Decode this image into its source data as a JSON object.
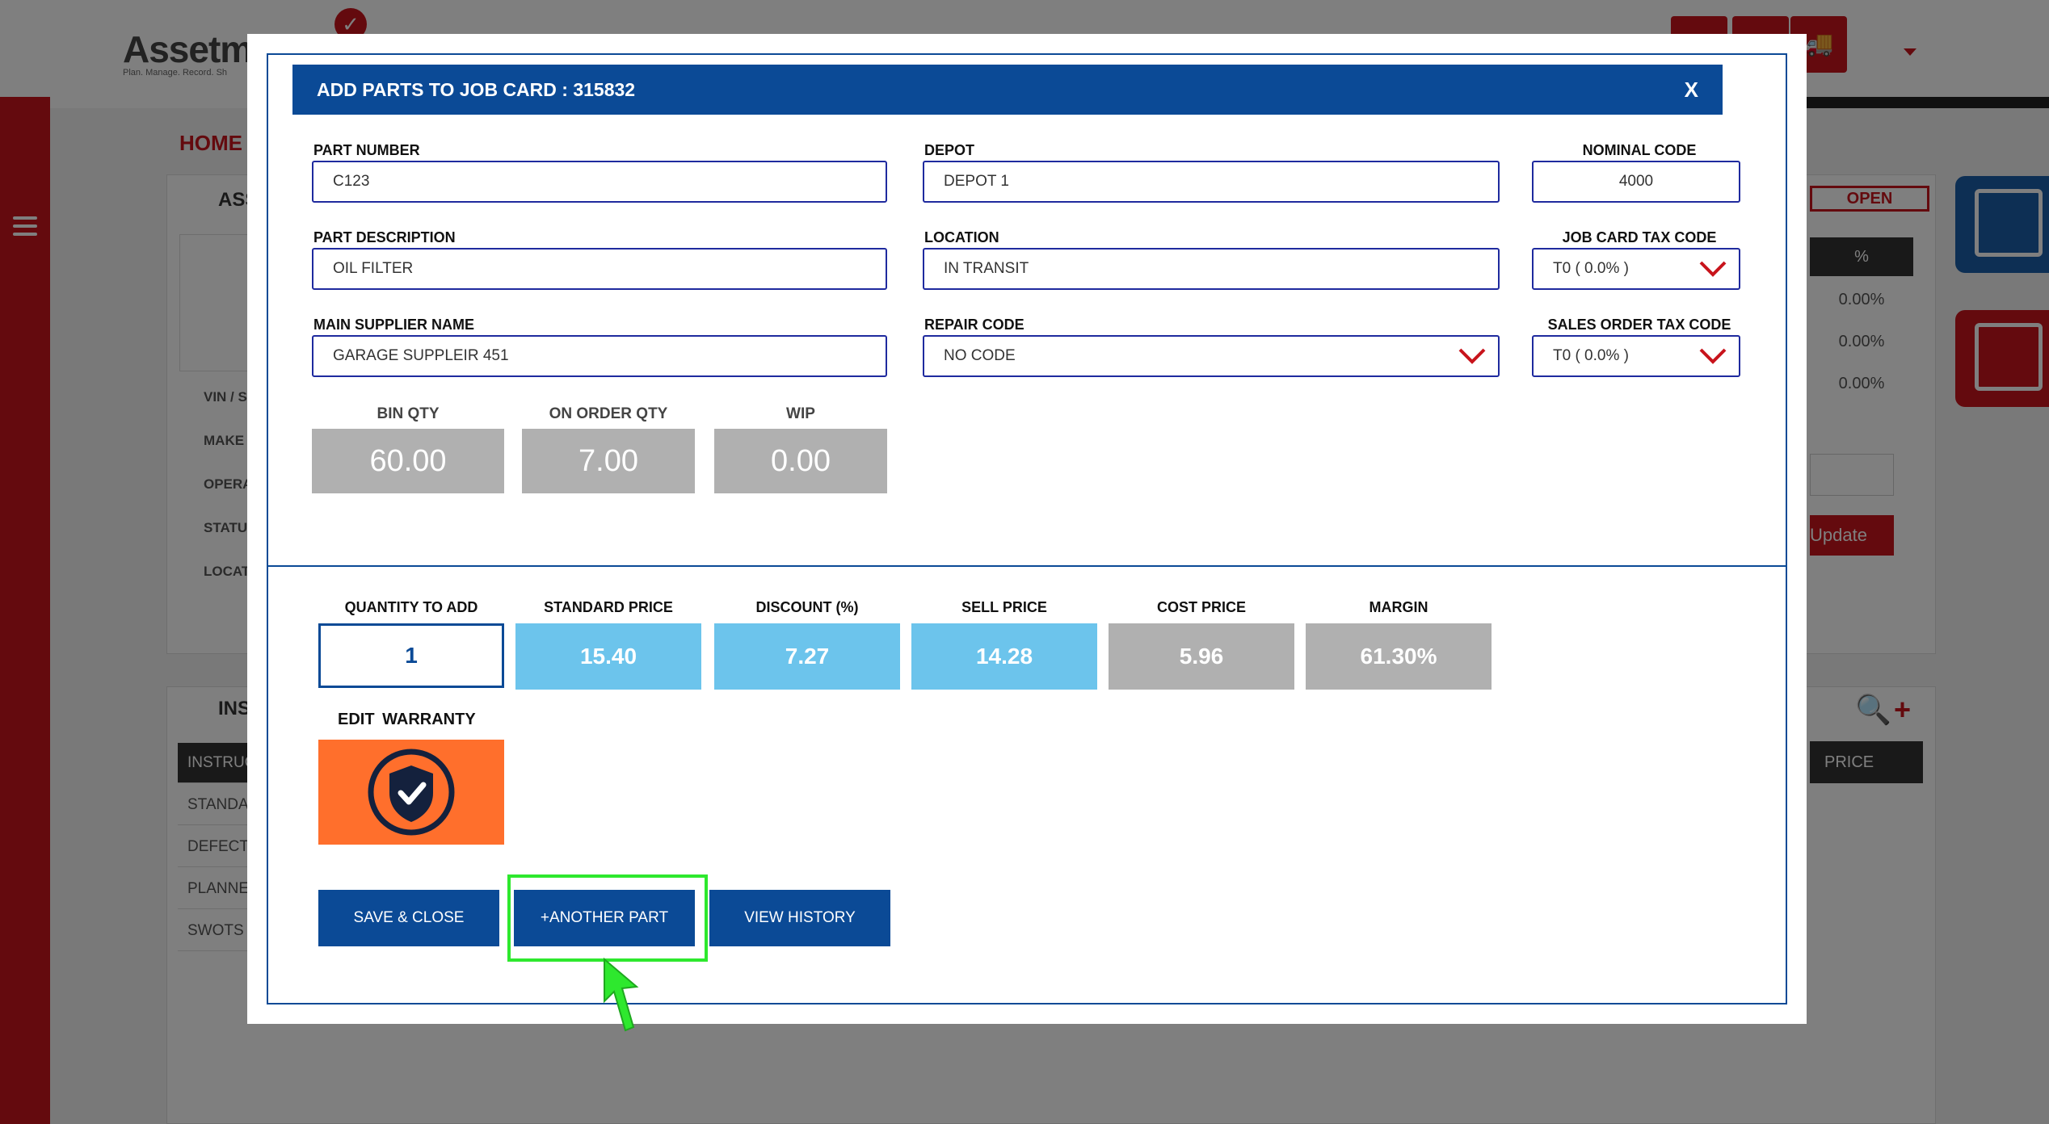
{
  "app": {
    "logo_text": "Assetm",
    "logo_tagline": "Plan. Manage. Record. Sh",
    "breadcrumb": "HOME F",
    "asset_panel_title": "ASS",
    "asset_fields": [
      "VIN / S",
      "MAKE /",
      "OPERA",
      "STATUS",
      "LOCAT"
    ],
    "instructions_panel_title": "INS",
    "instruction_items": [
      "INSTRUC",
      "STANDA",
      "DEFECT",
      "PLANNE",
      "SWOTS"
    ],
    "status_badge": "OPEN",
    "percent_header": "%",
    "percent_values": [
      "0.00%",
      "0.00%",
      "0.00%"
    ],
    "update_button": "Update",
    "price_header": "PRICE"
  },
  "modal": {
    "title": "ADD PARTS TO JOB CARD : 315832",
    "close_label": "X",
    "fields": {
      "part_number": {
        "label": "PART NUMBER",
        "value": "C123"
      },
      "depot": {
        "label": "DEPOT",
        "value": "DEPOT 1"
      },
      "nominal_code": {
        "label": "NOMINAL CODE",
        "value": "4000"
      },
      "part_description": {
        "label": "PART DESCRIPTION",
        "value": "OIL FILTER"
      },
      "location": {
        "label": "LOCATION",
        "value": "IN TRANSIT"
      },
      "job_card_tax_code": {
        "label": "JOB CARD TAX CODE",
        "value": "T0 ( 0.0% )"
      },
      "main_supplier_name": {
        "label": "MAIN SUPPLIER NAME",
        "value": "GARAGE SUPPLEIR 451"
      },
      "repair_code": {
        "label": "REPAIR CODE",
        "value": "NO CODE"
      },
      "sales_order_tax_code": {
        "label": "SALES ORDER TAX CODE",
        "value": "T0 ( 0.0% )"
      }
    },
    "stock": {
      "bin_qty": {
        "label": "BIN QTY",
        "value": "60.00"
      },
      "on_order_qty": {
        "label": "ON ORDER QTY",
        "value": "7.00"
      },
      "wip": {
        "label": "WIP",
        "value": "0.00"
      }
    },
    "pricing": {
      "quantity_to_add": {
        "label": "QUANTITY TO ADD",
        "value": "1"
      },
      "standard_price": {
        "label": "STANDARD PRICE",
        "value": "15.40"
      },
      "discount": {
        "label": "DISCOUNT (%)",
        "value": "7.27"
      },
      "sell_price": {
        "label": "SELL PRICE",
        "value": "14.28"
      },
      "cost_price": {
        "label": "COST PRICE",
        "value": "5.96"
      },
      "margin": {
        "label": "MARGIN",
        "value": "61.30%"
      }
    },
    "warranty": {
      "label": "EDIT  WARRANTY",
      "icon": "shield-check-icon",
      "color": "#ff6f2c"
    },
    "buttons": {
      "save_close": "SAVE & CLOSE",
      "another_part": "+ANOTHER PART",
      "view_history": "VIEW HISTORY"
    }
  },
  "colors": {
    "brand_red": "#c8141c",
    "modal_blue": "#0b4a96",
    "price_blue": "#6cc4ec",
    "readonly_grey": "#b0b0b0",
    "highlight_green": "#2ee82e"
  }
}
